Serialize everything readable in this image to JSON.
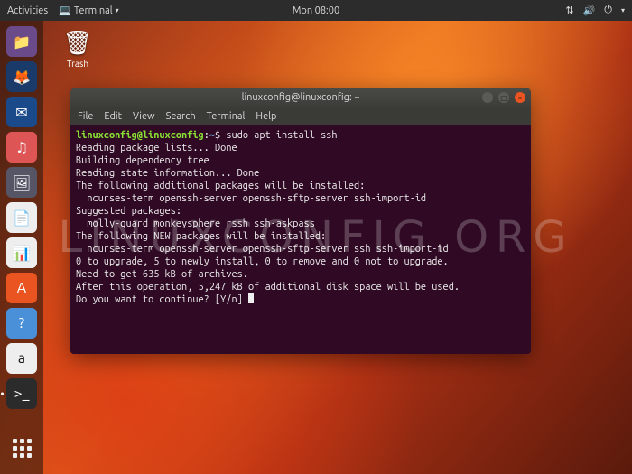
{
  "topbar": {
    "activities": "Activities",
    "app_menu": "Terminal",
    "clock": "Mon 08:00"
  },
  "dock": {
    "items": [
      {
        "name": "nautilus-icon",
        "glyph": "📁"
      },
      {
        "name": "firefox-icon",
        "glyph": "🦊"
      },
      {
        "name": "thunderbird-icon",
        "glyph": "✉"
      },
      {
        "name": "rhythmbox-icon",
        "glyph": "♫"
      },
      {
        "name": "shotwell-icon",
        "glyph": "🖼"
      },
      {
        "name": "writer-icon",
        "glyph": "📄"
      },
      {
        "name": "calc-icon",
        "glyph": "📊"
      },
      {
        "name": "software-icon",
        "glyph": "A"
      },
      {
        "name": "help-icon",
        "glyph": "?"
      },
      {
        "name": "amazon-icon",
        "glyph": "a"
      },
      {
        "name": "terminal-icon",
        "glyph": ">_"
      }
    ]
  },
  "desktop_icons": {
    "trash": "Trash"
  },
  "terminal": {
    "title": "linuxconfig@linuxconfig: ~",
    "menu": [
      "File",
      "Edit",
      "View",
      "Search",
      "Terminal",
      "Help"
    ],
    "prompt_user": "linuxconfig@linuxconfig",
    "prompt_sep": ":",
    "prompt_path": "~",
    "prompt_suffix": "$ ",
    "command": "sudo apt install ssh",
    "output": "Reading package lists... Done\nBuilding dependency tree\nReading state information... Done\nThe following additional packages will be installed:\n  ncurses-term openssh-server openssh-sftp-server ssh-import-id\nSuggested packages:\n  molly-guard monkeysphere rssh ssh-askpass\nThe following NEW packages will be installed:\n  ncurses-term openssh-server openssh-sftp-server ssh ssh-import-id\n0 to upgrade, 5 to newly install, 0 to remove and 0 not to upgrade.\nNeed to get 635 kB of archives.\nAfter this operation, 5,247 kB of additional disk space will be used.\nDo you want to continue? [Y/n] "
  },
  "watermark": "LINUXCONFIG.ORG"
}
